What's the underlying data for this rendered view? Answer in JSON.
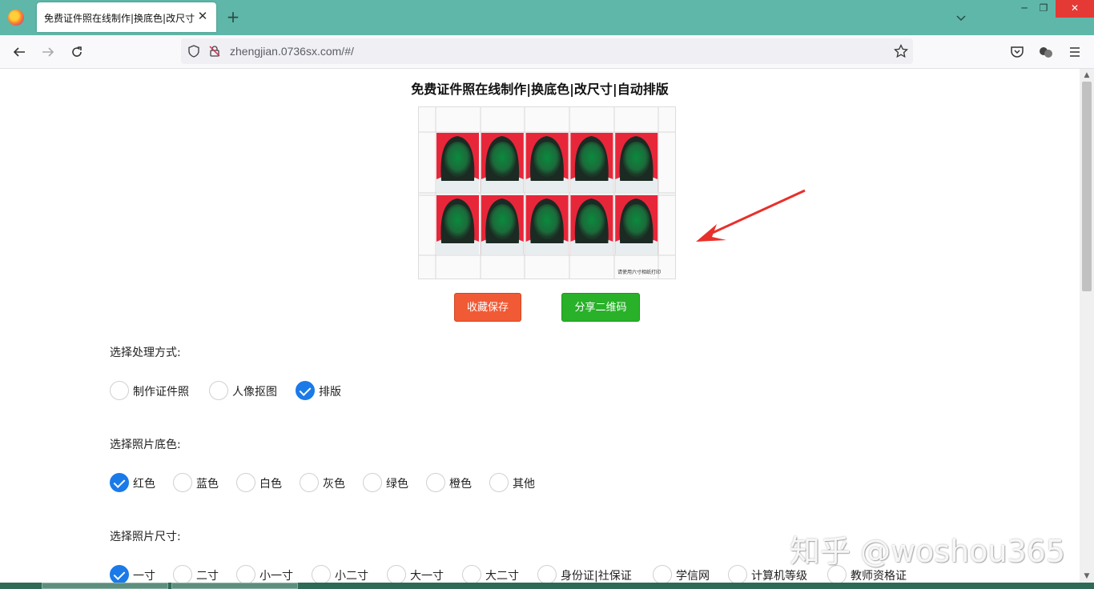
{
  "browser": {
    "tab_title": "免费证件照在线制作|换底色|改尺寸",
    "url": "zhengjian.0736sx.com/#/",
    "accent": "#5fb7a9"
  },
  "page": {
    "title": "免费证件照在线制作|换底色|改尺寸|自动排版",
    "sheet_note": "请使用六寸相纸打印",
    "buttons": {
      "save": "收藏保存",
      "share": "分享二维码"
    },
    "sections": [
      {
        "label": "选择处理方式:",
        "options": [
          {
            "label": "制作证件照",
            "checked": false
          },
          {
            "label": "人像抠图",
            "checked": false
          },
          {
            "label": "排版",
            "checked": true
          }
        ]
      },
      {
        "label": "选择照片底色:",
        "options": [
          {
            "label": "红色",
            "checked": true
          },
          {
            "label": "蓝色",
            "checked": false
          },
          {
            "label": "白色",
            "checked": false
          },
          {
            "label": "灰色",
            "checked": false
          },
          {
            "label": "绿色",
            "checked": false
          },
          {
            "label": "橙色",
            "checked": false
          },
          {
            "label": "其他",
            "checked": false
          }
        ]
      },
      {
        "label": "选择照片尺寸:",
        "options": [
          {
            "label": "一寸",
            "checked": true
          },
          {
            "label": "二寸",
            "checked": false
          },
          {
            "label": "小一寸",
            "checked": false
          },
          {
            "label": "小二寸",
            "checked": false
          },
          {
            "label": "大一寸",
            "checked": false
          },
          {
            "label": "大二寸",
            "checked": false
          },
          {
            "label": "身份证|社保证",
            "checked": false
          },
          {
            "label": "学信网",
            "checked": false
          },
          {
            "label": "计算机等级",
            "checked": false
          },
          {
            "label": "教师资格证",
            "checked": false
          }
        ]
      }
    ],
    "photo_background": "#e8263a",
    "save_color": "#f05a34",
    "share_color": "#28b129",
    "checked_color": "#1a7ae8"
  },
  "watermark": "知乎 @woshou365"
}
